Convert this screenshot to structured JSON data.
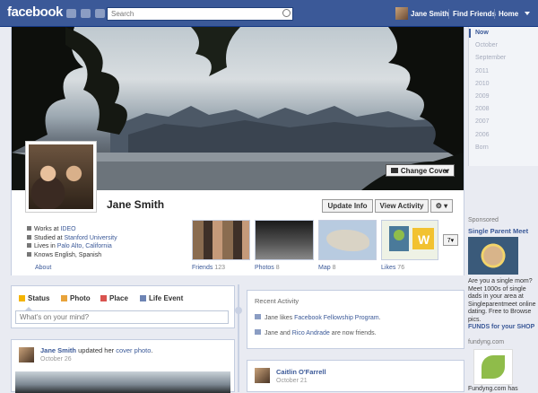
{
  "topbar": {
    "logo": "facebook",
    "search_placeholder": "Search",
    "user_name": "Jane Smith",
    "find_friends": "Find Friends",
    "home": "Home"
  },
  "cover": {
    "change_cover": "Change Cover"
  },
  "profile": {
    "name": "Jane Smith",
    "update_info": "Update Info",
    "view_activity": "View Activity",
    "gear_label": "⚙ ▾",
    "info": {
      "works_prefix": "Works at ",
      "works_link": "IDEO",
      "studied_prefix": "Studied at ",
      "studied_link": "Stanford University",
      "lives_prefix": "Lives in ",
      "lives_link": "Palo Alto, California",
      "knows": "Knows English, Spanish"
    },
    "about": "About"
  },
  "tiles": {
    "friends_label": "Friends",
    "friends_count": "123",
    "photos_label": "Photos",
    "photos_count": "8",
    "map_label": "Map",
    "map_count": "8",
    "likes_label": "Likes",
    "likes_count": "76",
    "more": "7▾"
  },
  "timeline_nav": [
    "Now",
    "October",
    "September",
    "2011",
    "2010",
    "2009",
    "2008",
    "2007",
    "2006",
    "Born"
  ],
  "sidebar": {
    "sponsored": "Sponsored",
    "ad1_title": "Single Parent Meet",
    "ad1_text": "Are you a single mom? Meet 1000s of single dads in your area at Singleparentmeet online dating. Free to Browse pics.",
    "ad2_title": "FUNDS for your SHOP",
    "ad2_source": "fundyng.com",
    "ad2_foot": "Fundyng.com has"
  },
  "composer": {
    "tab_status": "Status",
    "tab_photo": "Photo",
    "tab_place": "Place",
    "tab_life": "Life Event",
    "placeholder": "What's on your mind?"
  },
  "post1": {
    "author": "Jane Smith",
    "text_mid": " updated her ",
    "link": "cover photo",
    "text_end": ".",
    "date": "October 26"
  },
  "recent": {
    "title": "Recent Activity",
    "item1_prefix": "Jane likes ",
    "item1_link": "Facebook Fellowship Program",
    "item1_end": ".",
    "item2_prefix": "Jane and ",
    "item2_link": "Rico Andrade",
    "item2_end": " are now friends."
  },
  "post2": {
    "author": "Caitlin O'Farrell",
    "date": "October 21"
  }
}
